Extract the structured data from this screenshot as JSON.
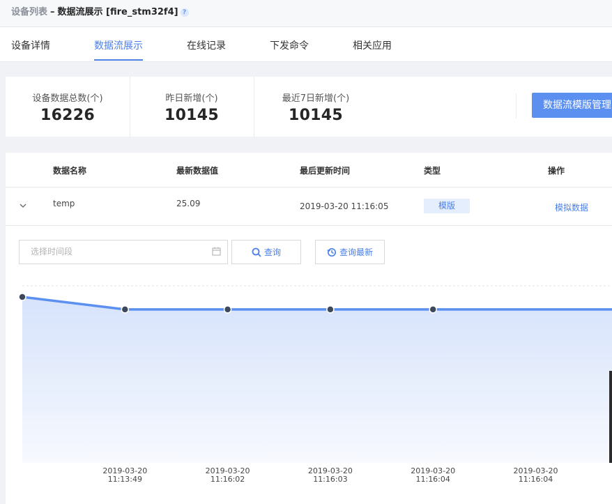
{
  "breadcrumb": {
    "root": "设备列表",
    "separator": "–",
    "current": "数据流展示 [fire_stm32f4]"
  },
  "tabs": [
    {
      "label": "设备详情",
      "active": false
    },
    {
      "label": "数据流展示",
      "active": true
    },
    {
      "label": "在线记录",
      "active": false
    },
    {
      "label": "下发命令",
      "active": false
    },
    {
      "label": "相关应用",
      "active": false
    }
  ],
  "stats": {
    "total_label": "设备数据总数(个)",
    "total_value": "16226",
    "yesterday_label": "昨日新增(个)",
    "yesterday_value": "10145",
    "week_label": "最近7日新增(个)",
    "week_value": "10145",
    "manage_button": "数据流模版管理"
  },
  "table": {
    "headers": [
      "数据名称",
      "最新数据值",
      "最后更新时间",
      "类型",
      "操作"
    ],
    "rows": [
      {
        "name": "temp",
        "value": "25.09",
        "updated": "2019-03-20 11:16:05",
        "type": "模版",
        "action": "模拟数据"
      }
    ]
  },
  "filter": {
    "range_placeholder": "选择时间段",
    "query_button": "查询",
    "latest_button": "查询最新"
  },
  "colors": {
    "accent": "#4a7fe8",
    "line": "#5b8ff0",
    "point": "#3d4a5c",
    "area": "#d6e3fb"
  },
  "chart_data": {
    "type": "area",
    "x": [
      "2019-03-20 11:13:49",
      "2019-03-20 11:16:02",
      "2019-03-20 11:16:03",
      "2019-03-20 11:16:04",
      "2019-03-20 11:16:04"
    ],
    "x_tick_labels": [
      [
        "2019-03-20",
        "11:13:49"
      ],
      [
        "2019-03-20",
        "11:16:02"
      ],
      [
        "2019-03-20",
        "11:16:03"
      ],
      [
        "2019-03-20",
        "11:16:04"
      ],
      [
        "2019-03-20",
        "11:16:04"
      ]
    ],
    "series": [
      {
        "values": [
          25.3,
          25.09,
          25.09,
          25.09,
          25.09,
          25.09
        ]
      }
    ],
    "grid": true,
    "legend": "none"
  }
}
